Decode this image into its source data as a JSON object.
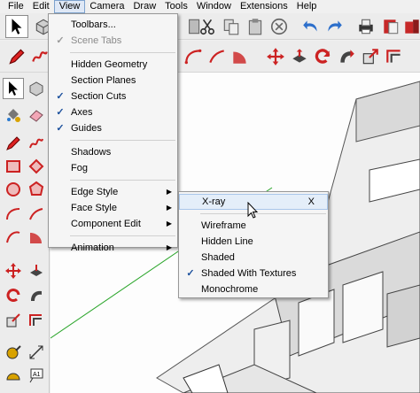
{
  "menubar": {
    "items": [
      "File",
      "Edit",
      "View",
      "Camera",
      "Draw",
      "Tools",
      "Window",
      "Extensions",
      "Help"
    ]
  },
  "view_menu": {
    "items": [
      {
        "label": "Toolbars...",
        "checked": false,
        "disabled": false
      },
      {
        "label": "Scene Tabs",
        "checked": true,
        "disabled": true
      },
      {
        "separator": true
      },
      {
        "label": "Hidden Geometry",
        "checked": false
      },
      {
        "label": "Section Planes",
        "checked": false
      },
      {
        "label": "Section Cuts",
        "checked": true
      },
      {
        "label": "Axes",
        "checked": true
      },
      {
        "label": "Guides",
        "checked": true
      },
      {
        "separator": true
      },
      {
        "label": "Shadows",
        "checked": false
      },
      {
        "label": "Fog",
        "checked": false
      },
      {
        "separator": true
      },
      {
        "label": "Edge Style",
        "submenu": true
      },
      {
        "label": "Face Style",
        "submenu": true
      },
      {
        "label": "Component Edit",
        "submenu": true
      },
      {
        "separator": true
      },
      {
        "label": "Animation",
        "submenu": true
      }
    ]
  },
  "face_style_menu": {
    "items": [
      {
        "label": "X-ray",
        "shortcut": "X",
        "highlighted": true
      },
      {
        "separator": true
      },
      {
        "label": "Wireframe"
      },
      {
        "label": "Hidden Line"
      },
      {
        "label": "Shaded"
      },
      {
        "label": "Shaded With Textures",
        "checked": true
      },
      {
        "label": "Monochrome"
      }
    ]
  },
  "palette": {
    "label_tool_text": "A1"
  },
  "colors": {
    "menu_highlight": "#e4eef9",
    "menu_highlight_border": "#a9c6ea",
    "check": "#1a4f9c",
    "axis_green": "#2aa52a",
    "model_gray": "#d6d6d6"
  }
}
